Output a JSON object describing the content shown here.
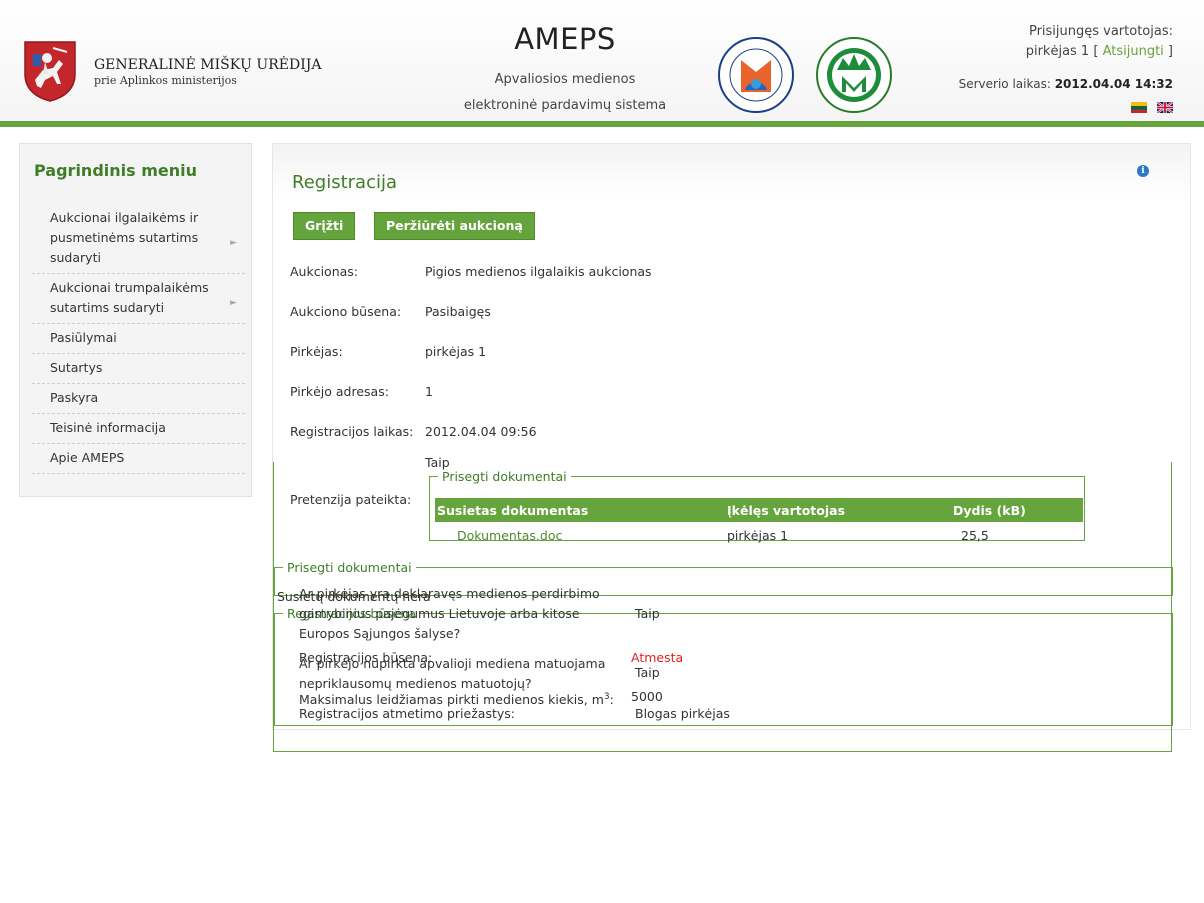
{
  "header": {
    "org_title": "GENERALINĖ MIŠKŲ URĖDIJA",
    "org_subtitle": "prie Aplinkos ministerijos",
    "app_title": "AMEPS",
    "app_subtitle_1": "Apvaliosios medienos",
    "app_subtitle_2": "elektroninė pardavimų sistema",
    "user_label": "Prisijungęs vartotojas:",
    "user_name": "pirkėjas 1",
    "logout_label": "Atsijungti",
    "server_label": "Serverio laikas:",
    "server_time": "2012.04.04 14:32",
    "brand_color": "#66a53d"
  },
  "sidebar": {
    "title": "Pagrindinis meniu",
    "items": [
      {
        "label": "Aukcionai ilgalaikėms ir pusmetinėms sutartims sudaryti",
        "has_submenu": true
      },
      {
        "label": "Aukcionai trumpalaikėms sutartims sudaryti",
        "has_submenu": true
      },
      {
        "label": "Pasiūlymai",
        "has_submenu": false
      },
      {
        "label": "Sutartys",
        "has_submenu": false
      },
      {
        "label": "Paskyra",
        "has_submenu": false
      },
      {
        "label": "Teisinė informacija",
        "has_submenu": false
      },
      {
        "label": "Apie AMEPS",
        "has_submenu": false
      }
    ]
  },
  "main": {
    "title": "Registracija",
    "back_button": "Grįžti",
    "view_button": "Peržiūrėti aukcioną",
    "fields": {
      "auction_label": "Aukcionas:",
      "auction_value": "Pigios medienos ilgalaikis aukcionas",
      "status_label": "Aukciono būsena:",
      "status_value": "Pasibaigęs",
      "buyer_label": "Pirkėjas:",
      "buyer_value": "pirkėjas 1",
      "address_label": "Pirkėjo adresas:",
      "address_value": "1",
      "regtime_label": "Registracijos laikas:",
      "regtime_value": "2012.04.04 09:56",
      "claim_label": "Pretenzija pateikta:",
      "claim_value": "Taip"
    },
    "claim_docs": {
      "legend": "Prisegti dokumentai",
      "columns": [
        "Susietas dokumentas",
        "Įkėlęs vartotojas",
        "Dydis (kB)"
      ],
      "rows": [
        [
          "Dokumentas.doc",
          "pirkėjas 1",
          "25,5"
        ]
      ]
    },
    "attached_docs": {
      "legend": "Prisegti dokumentai",
      "empty_text": "Susietų dokumentų nėra"
    },
    "registration_status": {
      "legend": "Registracijos būsena",
      "status_label": "Registracijos būsena:",
      "status_value": "Atmesta",
      "status_color": "#e02020",
      "max_label": "Maksimalus leidžiamas pirkti medienos kiekis, m",
      "max_unit_sup": "3",
      "max_label_suffix": ":",
      "max_value": "5000",
      "declared_label_1": "Ar pirkėjas yra deklaravęs medienos perdirbimo",
      "declared_label_2": "gamybinius pajėgumus Lietuvoje arba kitose",
      "declared_label_3": "Europos Sąjungos šalyse?",
      "declared_value": "Taip",
      "measured_label_1": "Ar pirkėjo nupirkta apvalioji mediena matuojama",
      "measured_label_2": "nepriklausomų medienos matuotojų?",
      "measured_value": "Taip",
      "reason_label": "Registracijos atmetimo priežastys:",
      "reason_value": "Blogas pirkėjas"
    }
  }
}
